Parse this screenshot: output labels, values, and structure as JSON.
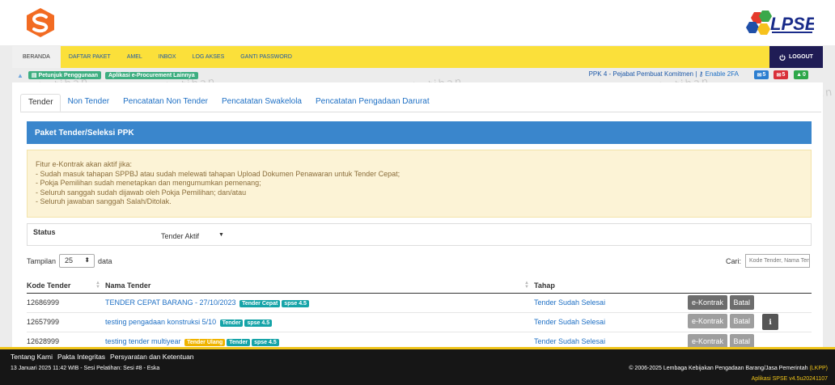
{
  "watermark": "Latihan",
  "nav": {
    "items": [
      "BERANDA",
      "DAFTAR PAKET",
      "AMEL",
      "INBOX",
      "LOG AKSES",
      "GANTI PASSWORD"
    ],
    "logout": "LOGOUT"
  },
  "subbar": {
    "pills": [
      "Petunjuk Penggunaan",
      "Aplikasi e-Procurement Lainnya"
    ],
    "role": "PPK 4 - Pejabat Pembuat Komitmen",
    "enable_2fa": "Enable 2FA",
    "badges": [
      {
        "icon": "mail-icon",
        "count": "5",
        "color": "#2d7fd0"
      },
      {
        "icon": "envelope-icon",
        "count": "5",
        "color": "#d9303a"
      },
      {
        "icon": "bell-icon",
        "count": "0",
        "color": "#2ea84a"
      }
    ]
  },
  "tabs": [
    "Tender",
    "Non Tender",
    "Pencatatan Non Tender",
    "Pencatatan Swakelola",
    "Pencatatan Pengadaan Darurat"
  ],
  "panel_title": "Paket Tender/Seleksi PPK",
  "alert": {
    "lines": [
      "Fitur e-Kontrak akan aktif jika:",
      "- Sudah masuk tahapan SPPBJ atau sudah melewati tahapan Upload Dokumen Penawaran untuk Tender Cepat;",
      "- Pokja Pemilihan sudah menetapkan dan mengumumkan pemenang;",
      "- Seluruh sanggah sudah dijawab oleh Pokja Pemilihan; dan/atau",
      "- Seluruh jawaban sanggah Salah/Ditolak."
    ]
  },
  "status": {
    "label": "Status",
    "value": "Tender Aktif"
  },
  "table_controls": {
    "show_label": "Tampilan",
    "page_size": "25",
    "show_suffix": "data",
    "search_label": "Cari:",
    "search_placeholder": "Kode Tender, Nama Tender"
  },
  "table": {
    "headers": [
      "Kode Tender",
      "Nama Tender",
      "Tahap"
    ],
    "rows": [
      {
        "kode": "12686999",
        "nama": "TENDER CEPAT BARANG - 27/10/2023",
        "tags": [
          "Tender Cepat",
          "spse 4.5"
        ],
        "tahap": "Tender Sudah Selesai",
        "kontrak": "e-Kontrak",
        "batal": "Batal"
      },
      {
        "kode": "12657999",
        "nama": "testing pengadaan konstruksi 5/10",
        "tags": [
          "Tender",
          "spse 4.5"
        ],
        "tahap": "Tender Sudah Selesai",
        "kontrak": "e-Kontrak",
        "batal": "Batal"
      },
      {
        "kode": "12628999",
        "nama": "testing tender multiyear",
        "tags": [
          "Tender Ulang",
          "Tender",
          "spse 4.5"
        ],
        "tahap": "Tender Sudah Selesai",
        "kontrak": "e-Kontrak",
        "batal": "Batal"
      }
    ]
  },
  "footer": {
    "links": [
      "Tentang Kami",
      "Pakta Integritas",
      "Persyaratan dan Ketentuan"
    ],
    "session": "13 Januari 2025 11:42 WIB - Sesi Pelatihan: Sesi #8 - Eska",
    "copyright": "© 2006-2025 Lembaga Kebijakan Pengadaan Barang/Jasa Pemerintah",
    "copyright_abbr": "(LKPP)",
    "version": "Aplikasi SPSE v4.5u20241107"
  },
  "colors": {
    "nav": "#fbe03a",
    "panel": "#3a86cc",
    "footer": "#161616",
    "accent": "#f0c419"
  }
}
